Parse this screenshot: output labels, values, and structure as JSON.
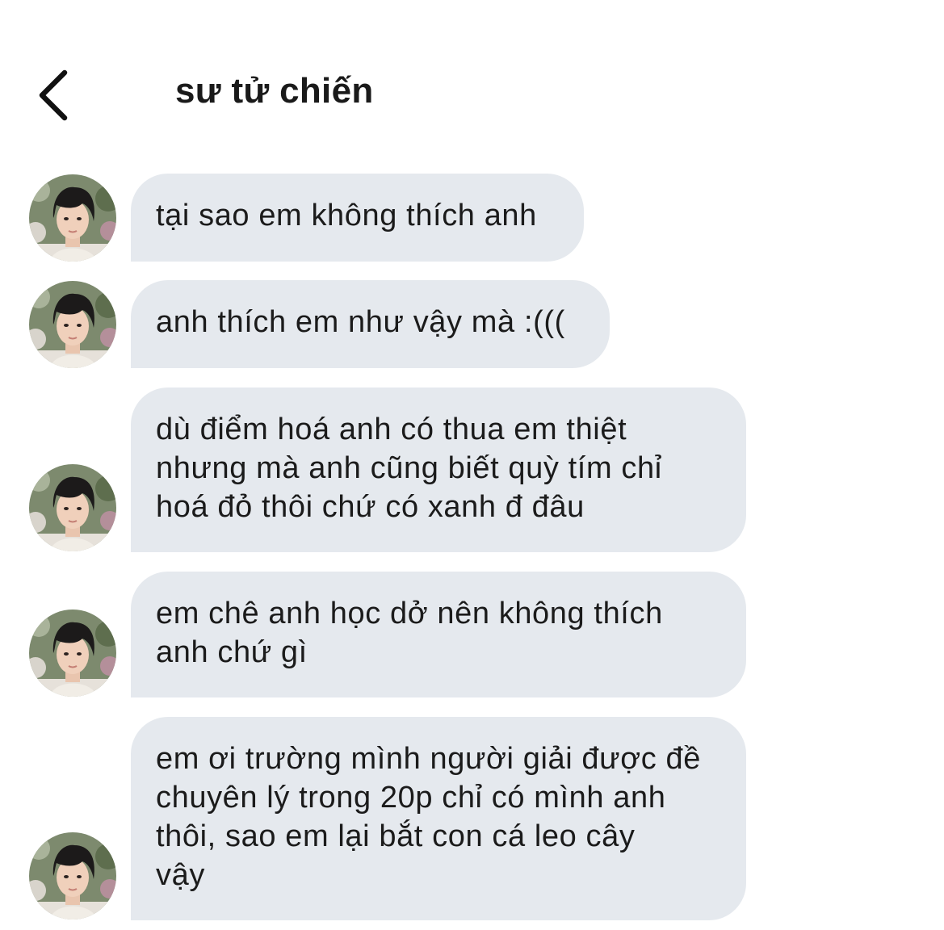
{
  "header": {
    "title": "sư tử chiến",
    "back_icon": "chevron-left-icon"
  },
  "messages": [
    {
      "lines": [
        "tại sao em không thích anh"
      ]
    },
    {
      "lines": [
        "anh thích em như vậy mà :((("
      ]
    },
    {
      "lines": [
        "dù điểm hoá anh có thua em thiệt",
        "nhưng mà anh cũng biết quỳ tím chỉ",
        "hoá đỏ thôi chứ có xanh đ đâu"
      ]
    },
    {
      "lines": [
        "em chê anh học dở nên không thích",
        "anh chứ gì"
      ]
    },
    {
      "lines": [
        "em ơi trường mình người giải được đề",
        "chuyên lý trong 20p chỉ có mình anh",
        "thôi, sao em lại bắt con cá leo cây",
        "vậy"
      ]
    }
  ],
  "colors": {
    "bubble": "#e5e9ee",
    "text": "#1b1b1b",
    "background": "#ffffff"
  }
}
